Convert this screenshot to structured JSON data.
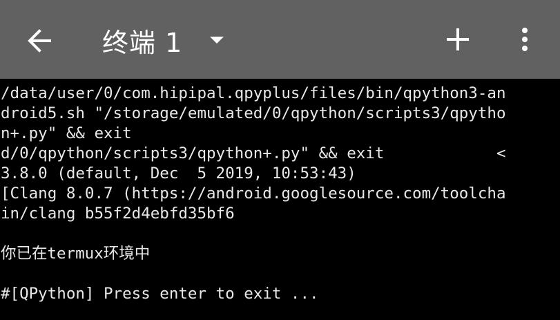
{
  "appbar": {
    "title": "终端 1",
    "background_color": "#616161",
    "back_icon": "arrow-left-icon",
    "dropdown_icon": "caret-down-icon",
    "add_icon": "plus-icon",
    "menu_icon": "more-vertical-icon"
  },
  "terminal": {
    "background_color": "#000000",
    "text_color": "#e8e8e8",
    "lines": [
      "/data/user/0/com.hipipal.qpyplus/files/bin/qpython3-an",
      "droid5.sh \"/storage/emulated/0/qpython/scripts3/qpytho",
      "n+.py\" && exit",
      "d/0/qpython/scripts3/qpython+.py\" && exit            <",
      "3.8.0 (default, Dec  5 2019, 10:53:43)",
      "[Clang 8.0.7 (https://android.googlesource.com/toolcha",
      "in/clang b55f2d4ebfd35bf6",
      "",
      "你已在termux环境中",
      "",
      "#[QPython] Press enter to exit ..."
    ]
  }
}
